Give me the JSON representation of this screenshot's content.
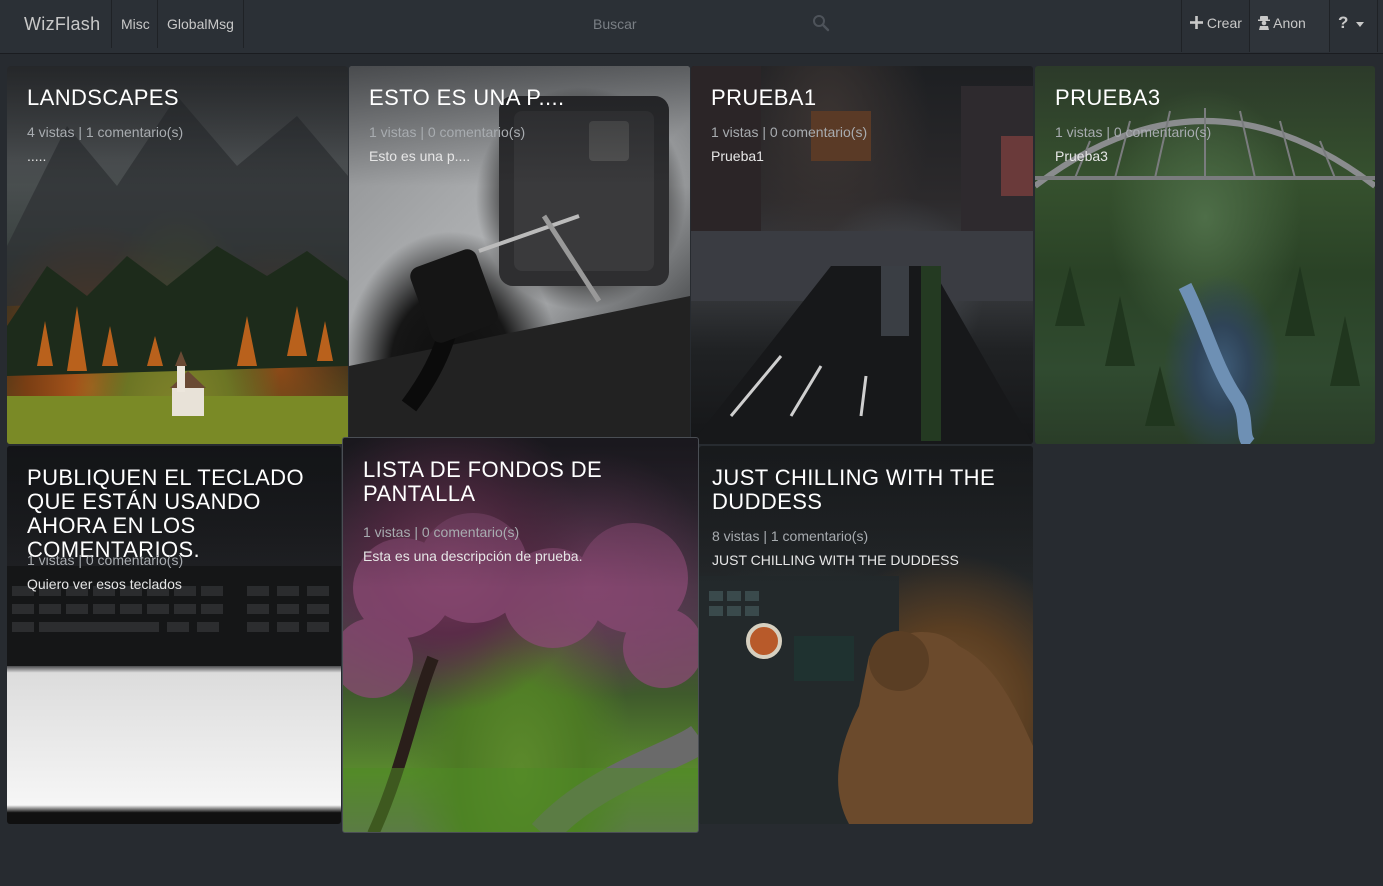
{
  "navbar": {
    "brand": "WizFlash",
    "links": [
      {
        "label": "Misc"
      },
      {
        "label": "GlobalMsg"
      }
    ],
    "search": {
      "placeholder": "Buscar",
      "value": ""
    },
    "crear_label": "Crear",
    "user_label": "Anon",
    "help_label": "?"
  },
  "cards": [
    {
      "title": "LANDSCAPES",
      "stats": "4 vistas | 1 comentario(s)",
      "description": "....."
    },
    {
      "title": "ESTO ES UNA P....",
      "stats": "1 vistas | 0 comentario(s)",
      "description": "Esto es una p...."
    },
    {
      "title": "PRUEBA1",
      "stats": "1 vistas | 0 comentario(s)",
      "description": "Prueba1"
    },
    {
      "title": "PRUEBA3",
      "stats": "1 vistas | 0 comentario(s)",
      "description": "Prueba3"
    },
    {
      "title": "PUBLIQUEN EL TECLADO QUE ESTÁN USANDO AHORA EN LOS COMENTARIOS.",
      "stats": "1 vistas | 0 comentario(s)",
      "description": "Quiero ver esos teclados"
    },
    {
      "title": "LISTA DE FONDOS DE PANTALLA",
      "stats": "1 vistas | 0 comentario(s)",
      "description": "Esta es una descripción de prueba."
    },
    {
      "title": "JUST CHILLING WITH THE DUDDESS",
      "stats": "8 vistas | 1 comentario(s)",
      "description": "JUST CHILLING WITH THE DUDDESS"
    }
  ],
  "colors": {
    "background": "#272b30",
    "navbar": "#2b3036",
    "text": "#c8c8c8",
    "title": "#ffffff"
  }
}
